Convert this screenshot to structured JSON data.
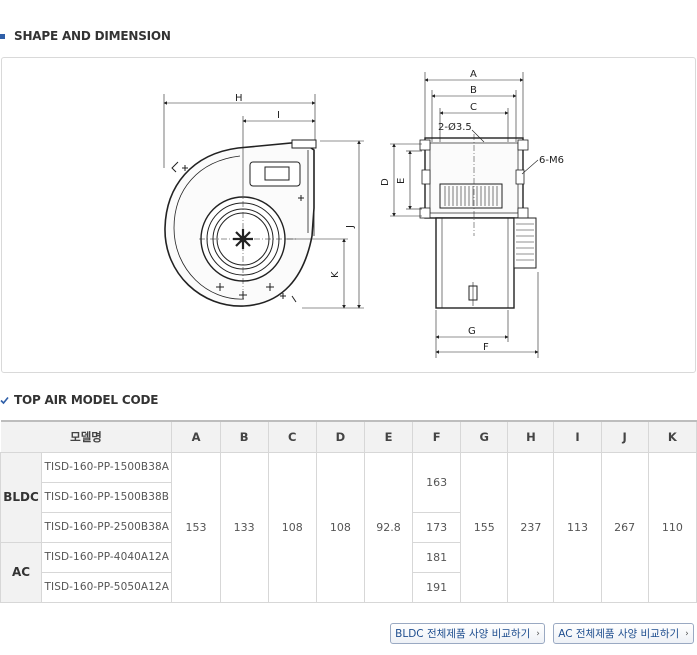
{
  "sections": {
    "shape_title": "SHAPE AND DIMENSION",
    "model_title": "TOP AIR MODEL CODE"
  },
  "drawing": {
    "labels": {
      "H": "H",
      "I": "I",
      "J": "J",
      "K": "K",
      "A": "A",
      "B": "B",
      "C": "C",
      "D": "D",
      "E": "E",
      "F": "F",
      "G": "G",
      "hole": "2-Ø3.5",
      "screw": "6-M6"
    }
  },
  "table": {
    "headers": [
      "모델명",
      "A",
      "B",
      "C",
      "D",
      "E",
      "F",
      "G",
      "H",
      "I",
      "J",
      "K"
    ],
    "categories": {
      "bldc": "BLDC",
      "ac": "AC"
    },
    "models": [
      "TISD-160-PP-1500B38A",
      "TISD-160-PP-1500B38B",
      "TISD-160-PP-2500B38A",
      "TISD-160-PP-4040A12A",
      "TISD-160-PP-5050A12A"
    ],
    "common": {
      "A": "153",
      "B": "133",
      "C": "108",
      "D": "108",
      "E": "92.8",
      "G": "155",
      "H": "237",
      "I": "113",
      "J": "267",
      "K": "110"
    },
    "f_values": [
      "163",
      "173",
      "181",
      "191"
    ]
  },
  "buttons": {
    "bldc_compare": "BLDC 전체제품 사양 비교하기",
    "ac_compare": "AC 전체제품 사양 비교하기"
  },
  "colors": {
    "accent": "#2f5fa8",
    "link": "#1f4e8f"
  }
}
